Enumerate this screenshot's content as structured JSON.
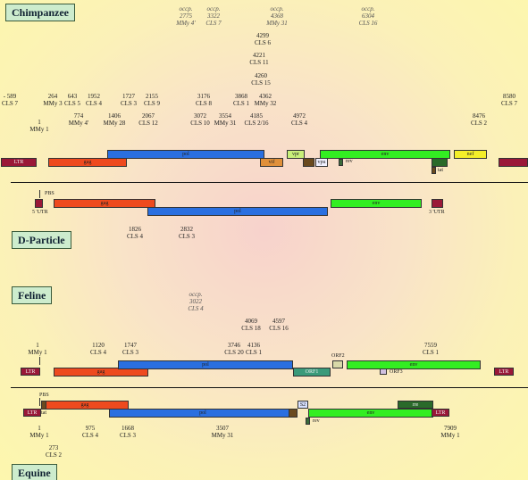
{
  "titles": {
    "chimpanzee": "Chimpanzee",
    "d_particle": "D-Particle",
    "feline": "Feline",
    "equine": "Equine"
  },
  "chimp_occp": [
    {
      "line1": "occp.",
      "line2": "2775",
      "line3": "MMy 4'"
    },
    {
      "line1": "occp.",
      "line2": "3322",
      "line3": "CLS 7"
    },
    {
      "line1": "occp.",
      "line2": "4368",
      "line3": "MMy 31"
    },
    {
      "line1": "occp.",
      "line2": "6304",
      "line3": "CLS 16"
    }
  ],
  "chimp_top": [
    {
      "num": "4299",
      "cls": "CLS 6"
    },
    {
      "num": "4221",
      "cls": "CLS 11"
    },
    {
      "num": "4260",
      "cls": "CLS 15"
    }
  ],
  "chimp_row1": [
    {
      "num": "- 589",
      "cls": "CLS 7"
    },
    {
      "num": "264",
      "cls": "MMy 3"
    },
    {
      "num": "643",
      "cls": "CLS 5"
    },
    {
      "num": "1952",
      "cls": "CLS 4"
    },
    {
      "num": "1727",
      "cls": "CLS 3"
    },
    {
      "num": "2155",
      "cls": "CLS 9"
    },
    {
      "num": "3176",
      "cls": "CLS 8"
    },
    {
      "num": "3868",
      "cls": "CLS 1"
    },
    {
      "num": "4362",
      "cls": "MMy 32"
    },
    {
      "num": "8580",
      "cls": "CLS 7"
    }
  ],
  "chimp_row2": [
    {
      "num": "774",
      "cls": "MMy 4'"
    },
    {
      "num": "1406",
      "cls": "MMy 28"
    },
    {
      "num": "2067",
      "cls": "CLS 12"
    },
    {
      "num": "3072",
      "cls": "CLS 10"
    },
    {
      "num": "3554",
      "cls": "MMy 31"
    },
    {
      "num": "4185",
      "cls": "CLS 2/16"
    },
    {
      "num": "4972",
      "cls": "CLS 4"
    },
    {
      "num": "8476",
      "cls": "CLS 2"
    }
  ],
  "chimp_start": {
    "num": "1",
    "cls": "MMy 1"
  },
  "chimp_genes": {
    "ltr5": "LTR",
    "gag": "gag",
    "pol": "pol",
    "vif": "vif",
    "vpr": "vpr",
    "vpu": "vpu",
    "env": "env",
    "rev": "rev",
    "tat": "tat",
    "nef": "nef",
    "ltr3": ""
  },
  "dp_labels": {
    "pbs": "PBS",
    "utr5": "5 'UTR",
    "utr3": "3 'UTR"
  },
  "dp_genes": {
    "gag": "gag",
    "pol": "pol",
    "env": "env"
  },
  "dp_below": [
    {
      "num": "1826",
      "cls": "CLS 4"
    },
    {
      "num": "2832",
      "cls": "CLS 3"
    }
  ],
  "feline_occp": {
    "line1": "occp.",
    "line2": "3022",
    "line3": "CLS 4"
  },
  "feline_top": [
    {
      "num": "4069",
      "cls": "CLS 18"
    },
    {
      "num": "4597",
      "cls": "CLS 16"
    }
  ],
  "feline_row": [
    {
      "num": "1",
      "cls": "MMy 1"
    },
    {
      "num": "1120",
      "cls": "CLS 4"
    },
    {
      "num": "1747",
      "cls": "CLS 3"
    },
    {
      "num": "3746",
      "cls": "CLS 20"
    },
    {
      "num": "4136",
      "cls": "CLS 1"
    },
    {
      "num": "7559",
      "cls": "CLS 1"
    }
  ],
  "feline_genes": {
    "ltr5": "LTR",
    "gag": "gag",
    "pol": "pol",
    "orf1": "ORF1",
    "orf2": "ORF2",
    "orf3": "ORF3",
    "env": "env",
    "ltr3": "LTR"
  },
  "equine_labels": {
    "pbs": "PBS",
    "tat": "tat",
    "rev": "rev"
  },
  "equine_genes": {
    "ltr5": "LTR",
    "gag": "gag",
    "pol": "pol",
    "s2": "S2",
    "env": "env",
    "ltr3": "LTR",
    "rre": "rre"
  },
  "equine_below": [
    {
      "num": "1",
      "cls": "MMy 1"
    },
    {
      "num": "975",
      "cls": "CLS 4"
    },
    {
      "num": "1668",
      "cls": "CLS 3"
    },
    {
      "num": "3507",
      "cls": "MMy 31"
    },
    {
      "num": "7909",
      "cls": "MMy 1"
    }
  ],
  "equine_extra": {
    "num": "273",
    "cls": "CLS 2"
  },
  "colors": {
    "gag": "#ee4a1e",
    "pol": "#2a6fe0",
    "env": "#33ee22",
    "ltr": "#9a1838",
    "vif": "#e0903a",
    "vpr": "#c8f07a",
    "vpu": "#f0f0ff",
    "nef": "#f4ee2a",
    "orf1": "#3a9a7a",
    "orf2": "#d8d8a8",
    "orf3": "#d0c0e0",
    "tat": "#2a6a2a",
    "rev": "#3a6a3a",
    "s2": "#d8e0ff"
  }
}
